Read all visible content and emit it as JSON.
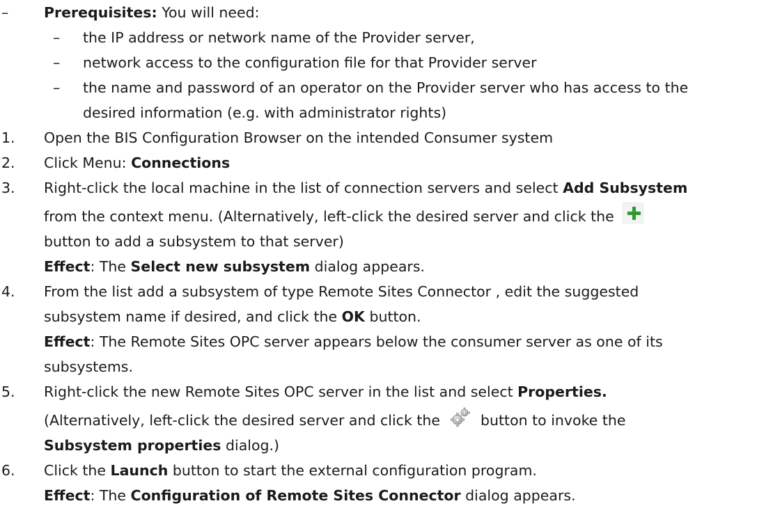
{
  "prerequisites": {
    "marker": "–",
    "label": "Prerequisites:",
    "text": " You will need:",
    "items": [
      {
        "marker": "–",
        "text": "the IP address or network name of the Provider server,"
      },
      {
        "marker": "–",
        "text": "network access to the configuration file for that Provider server"
      },
      {
        "marker": "–",
        "text": "the name and password of an operator on the Provider server who has access to the"
      },
      {
        "marker": "",
        "text": "desired information (e.g. with administrator rights)"
      }
    ]
  },
  "steps": [
    {
      "num": "1.",
      "text": "Open the BIS Configuration Browser on the intended Consumer system"
    },
    {
      "num": "2.",
      "pre": "Click Menu: ",
      "bold": "Connections"
    },
    {
      "num": "3.",
      "l1_pre": "Right-click the local machine in the list of connection servers and select ",
      "l1_bold": "Add Subsystem",
      "l2_pre": "from the context menu. (Alternatively, left-click the desired server and click the",
      "l3": "button to add a subsystem to that server)",
      "effect_label": "Effect",
      "effect_pre": ": The ",
      "effect_bold": "Select new subsystem",
      "effect_post": " dialog appears."
    },
    {
      "num": "4.",
      "l1": "From the list add a subsystem of type Remote Sites Connector , edit the suggested",
      "l2_pre": "subsystem name if desired, and click the ",
      "l2_bold": "OK",
      "l2_post": " button.",
      "effect_label": "Effect",
      "effect_text": ": The Remote Sites OPC server appears below the consumer server as one of its",
      "l4": "subsystems."
    },
    {
      "num": "5.",
      "l1_pre": "Right-click the new Remote Sites OPC server in the list and select ",
      "l1_bold": "Properties.",
      "l2_pre": "(Alternatively, left-click the desired server and click the",
      "l2_post": "button to invoke the",
      "l3_bold": "Subsystem properties",
      "l3_post": " dialog.)"
    },
    {
      "num": "6.",
      "l1_pre": "Click the ",
      "l1_bold": "Launch",
      "l1_post": " button to start the external configuration program.",
      "effect_label": "Effect",
      "effect_pre": ": The ",
      "effect_bold": "Configuration of Remote Sites Connector",
      "effect_post": " dialog appears."
    }
  ],
  "icons": {
    "add": "plus-icon",
    "properties": "gear-icon",
    "add_color": "#2f9a2f"
  }
}
